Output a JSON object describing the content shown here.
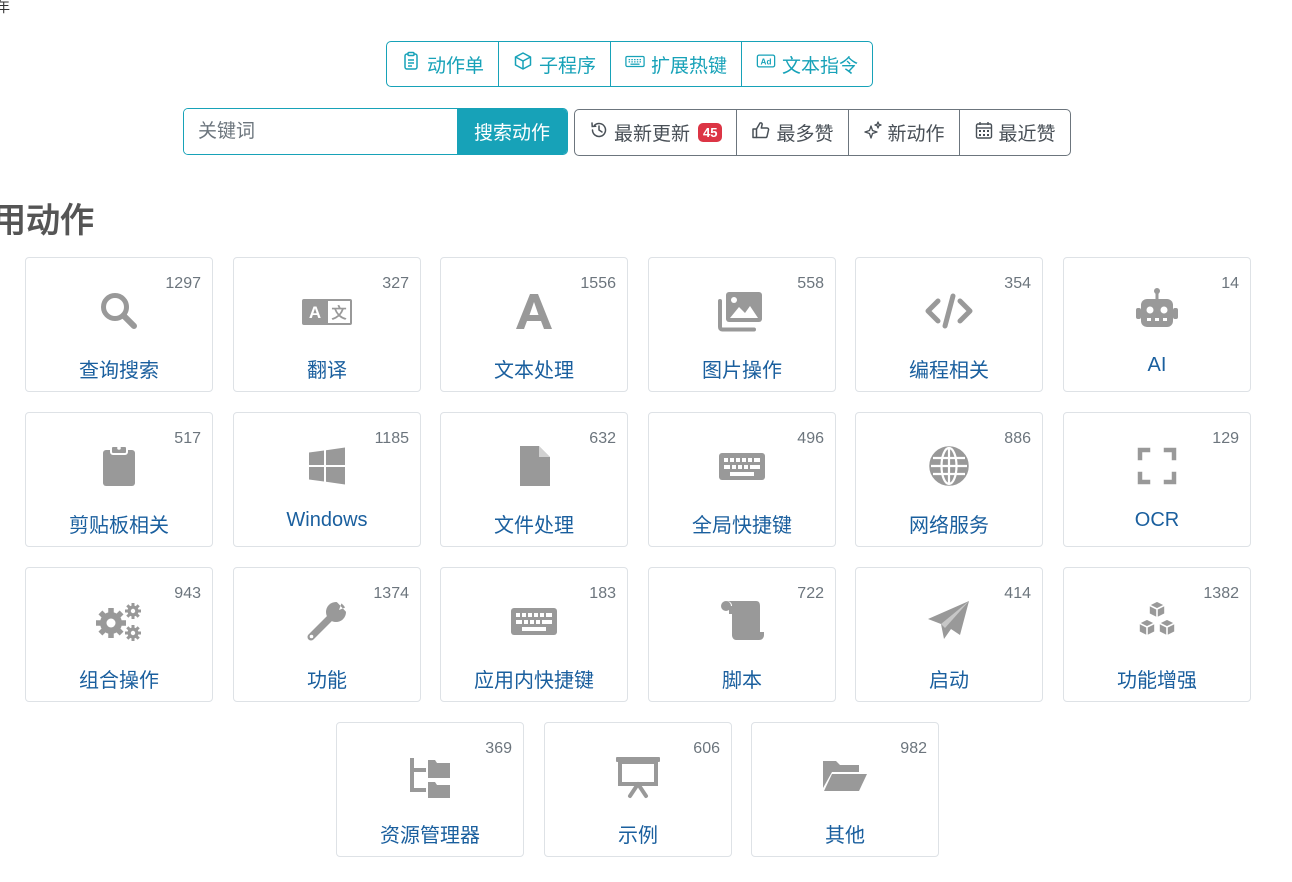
{
  "corner_glyph": "年",
  "nav": [
    {
      "label": "动作单",
      "icon": "clipboard-list-icon"
    },
    {
      "label": "子程序",
      "icon": "cube-icon"
    },
    {
      "label": "扩展热键",
      "icon": "keyboard-icon"
    },
    {
      "label": "文本指令",
      "icon": "ad-text-icon"
    }
  ],
  "search": {
    "placeholder": "关键词",
    "value": "",
    "button": "搜索动作"
  },
  "sort": [
    {
      "label": "最新更新",
      "icon": "history-icon",
      "badge": "45"
    },
    {
      "label": "最多赞",
      "icon": "thumbs-up-icon"
    },
    {
      "label": "新动作",
      "icon": "sparkles-icon"
    },
    {
      "label": "最近赞",
      "icon": "calendar-icon"
    }
  ],
  "section_title": "用动作",
  "categories": [
    {
      "label": "查询搜索",
      "count": "1297",
      "icon": "search-icon"
    },
    {
      "label": "翻译",
      "count": "327",
      "icon": "translate-icon"
    },
    {
      "label": "文本处理",
      "count": "1556",
      "icon": "font-icon"
    },
    {
      "label": "图片操作",
      "count": "558",
      "icon": "images-icon"
    },
    {
      "label": "编程相关",
      "count": "354",
      "icon": "code-icon"
    },
    {
      "label": "AI",
      "count": "14",
      "icon": "robot-icon"
    },
    {
      "label": "剪贴板相关",
      "count": "517",
      "icon": "clipboard-icon"
    },
    {
      "label": "Windows",
      "count": "1185",
      "icon": "windows-icon"
    },
    {
      "label": "文件处理",
      "count": "632",
      "icon": "file-icon"
    },
    {
      "label": "全局快捷键",
      "count": "496",
      "icon": "keyboard-icon"
    },
    {
      "label": "网络服务",
      "count": "886",
      "icon": "globe-icon"
    },
    {
      "label": "OCR",
      "count": "129",
      "icon": "expand-icon"
    },
    {
      "label": "组合操作",
      "count": "943",
      "icon": "gears-icon"
    },
    {
      "label": "功能",
      "count": "1374",
      "icon": "wrench-icon"
    },
    {
      "label": "应用内快捷键",
      "count": "183",
      "icon": "keyboard-icon"
    },
    {
      "label": "脚本",
      "count": "722",
      "icon": "scroll-icon"
    },
    {
      "label": "启动",
      "count": "414",
      "icon": "paper-plane-icon"
    },
    {
      "label": "功能增强",
      "count": "1382",
      "icon": "cubes-icon"
    },
    {
      "label": "资源管理器",
      "count": "369",
      "icon": "folder-tree-icon"
    },
    {
      "label": "示例",
      "count": "606",
      "icon": "presentation-icon"
    },
    {
      "label": "其他",
      "count": "982",
      "icon": "folder-open-icon"
    }
  ],
  "colors": {
    "accent": "#17a2b8",
    "icon_gray": "#999999",
    "label_blue": "#1a5f9e",
    "badge_red": "#dc3545"
  }
}
